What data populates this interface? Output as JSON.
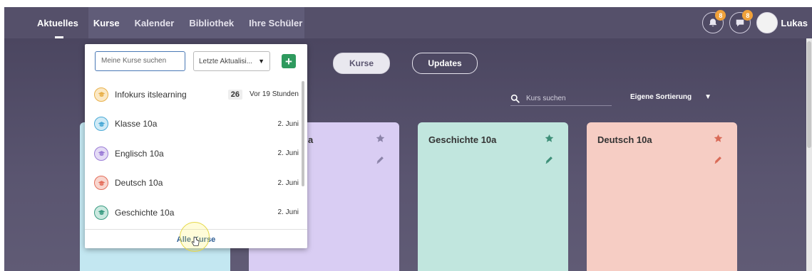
{
  "nav": {
    "items": [
      {
        "label": "Aktuelles"
      },
      {
        "label": "Kurse"
      },
      {
        "label": "Kalender"
      },
      {
        "label": "Bibliothek"
      },
      {
        "label": "Ihre Schüler"
      }
    ],
    "notifications_badge": "8",
    "messages_badge": "8",
    "user_name": "Lukas"
  },
  "toggle": {
    "kurse_label": "Kurse",
    "updates_label": "Updates"
  },
  "search": {
    "placeholder": "Kurs suchen"
  },
  "sort": {
    "label": "Eigene Sortierung"
  },
  "cards": [
    {
      "title": "",
      "color": "#c3e7f1"
    },
    {
      "title": "a",
      "color": "#d9cdf3"
    },
    {
      "title": "Geschichte 10a",
      "color": "#c1e6de"
    },
    {
      "title": "Deutsch 10a",
      "color": "#f6cdc4"
    }
  ],
  "dropdown": {
    "search_placeholder": "Meine Kurse suchen",
    "sort_select_value": "Letzte Aktualisi...",
    "add_label": "+",
    "courses": [
      {
        "name": "Infokurs itslearning",
        "count": "26",
        "date": "Vor 19 Stunden",
        "color": "#e8b04a"
      },
      {
        "name": "Klasse 10a",
        "count": "",
        "date": "2. Juni",
        "color": "#4aa9d6"
      },
      {
        "name": "Englisch 10a",
        "count": "",
        "date": "2. Juni",
        "color": "#9a7bd6"
      },
      {
        "name": "Deutsch 10a",
        "count": "",
        "date": "2. Juni",
        "color": "#e46f5c"
      },
      {
        "name": "Geschichte 10a",
        "count": "",
        "date": "2. Juni",
        "color": "#3a9c82"
      }
    ],
    "all_courses_label": "Alle Kurse"
  }
}
